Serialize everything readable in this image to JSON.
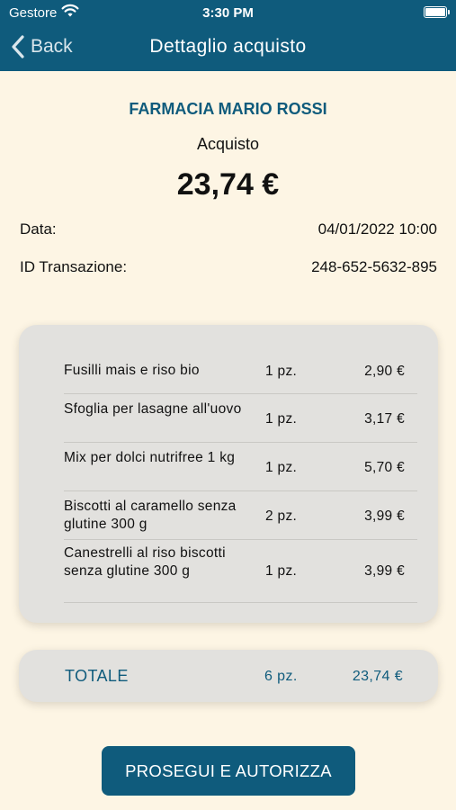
{
  "status_bar": {
    "carrier": "Gestore",
    "time": "3:30 PM"
  },
  "nav": {
    "back_label": "Back",
    "title": "Dettaglio acquisto"
  },
  "header": {
    "shop_name": "FARMACIA MARIO ROSSI",
    "kind": "Acquisto",
    "amount": "23,74 €"
  },
  "details": [
    {
      "label": "Data:",
      "value": "04/01/2022 10:00"
    },
    {
      "label": "ID Transazione:",
      "value": "248-652-5632-895"
    }
  ],
  "items": [
    {
      "name": "Fusilli mais e riso bio",
      "qty": "1 pz.",
      "price": "2,90 €"
    },
    {
      "name": "Sfoglia per lasagne all'uovo",
      "qty": "1 pz.",
      "price": "3,17 €"
    },
    {
      "name": "Mix per dolci nutrifree 1 kg",
      "qty": "1 pz.",
      "price": "5,70 €"
    },
    {
      "name": "Biscotti al caramello senza glutine 300 g",
      "qty": "2 pz.",
      "price": "3,99 €"
    },
    {
      "name": "Canestrelli al riso biscotti senza glutine 300 g",
      "qty": "1 pz.",
      "price": "3,99 €"
    }
  ],
  "total": {
    "label": "TOTALE",
    "qty": "6 pz.",
    "amount": "23,74 €"
  },
  "cta_label": "PROSEGUI E AUTORIZZA",
  "colors": {
    "primary": "#0f5b7c",
    "background": "#fdf5e4",
    "card": "#e2e1de"
  }
}
